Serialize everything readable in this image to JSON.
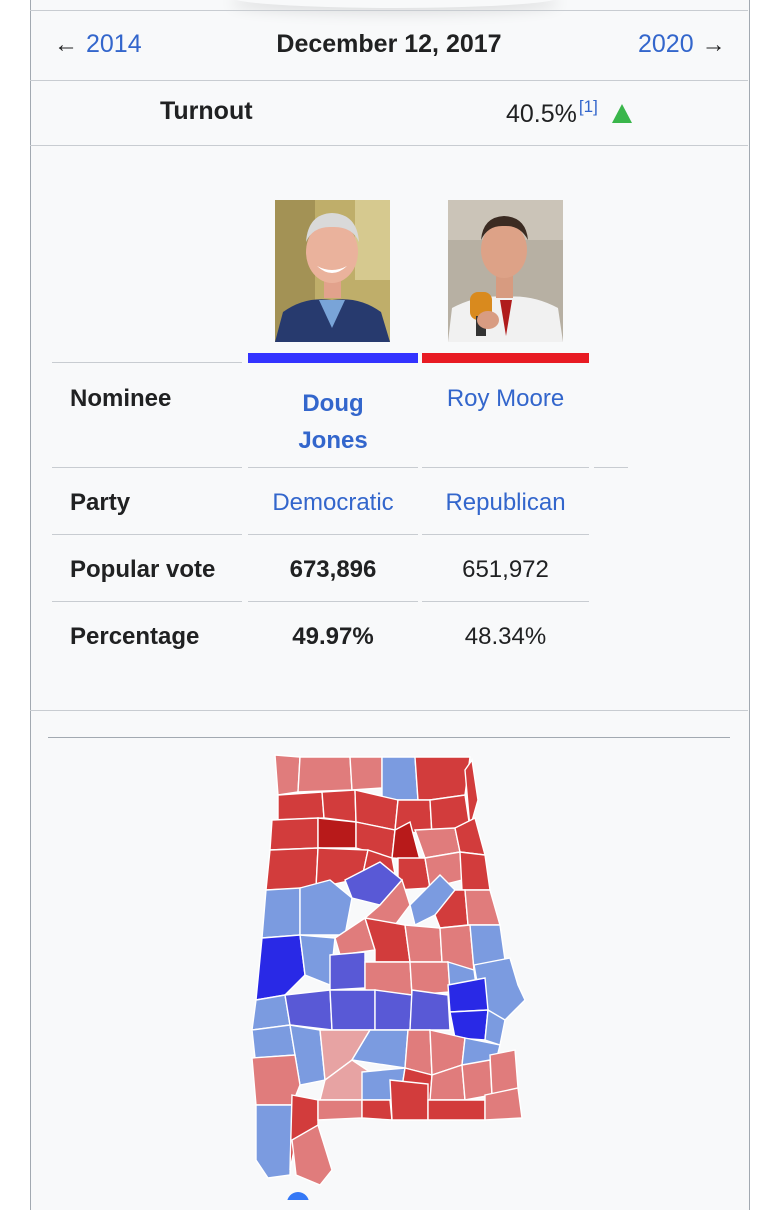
{
  "navigation": {
    "prev_year": "2014",
    "prev_arrow": "←",
    "election_date": "December 12, 2017",
    "next_year": "2020",
    "next_arrow": "→"
  },
  "turnout": {
    "label": "Turnout",
    "value": "40.5%",
    "citation": "[1]",
    "trend": "up"
  },
  "candidates": [
    {
      "nominee": "Doug Jones",
      "nominee_line1": "Doug",
      "nominee_line2": "Jones",
      "party": "Democratic",
      "popular_vote": "673,896",
      "percentage": "49.97%",
      "winner": true,
      "color": "#3333ff"
    },
    {
      "nominee": "Roy Moore",
      "party": "Republican",
      "popular_vote": "651,972",
      "percentage": "48.34%",
      "winner": false,
      "color": "#e81b23"
    }
  ],
  "row_labels": {
    "nominee": "Nominee",
    "party": "Party",
    "popular_vote": "Popular vote",
    "percentage": "Percentage"
  },
  "colors": {
    "link": "#3366cc",
    "dem_strong": "#2929e6",
    "dem": "#5959d6",
    "dem_light": "#7b9be0",
    "rep_strong": "#b81a1a",
    "rep": "#d23c3c",
    "rep_light": "#e07c7c"
  }
}
